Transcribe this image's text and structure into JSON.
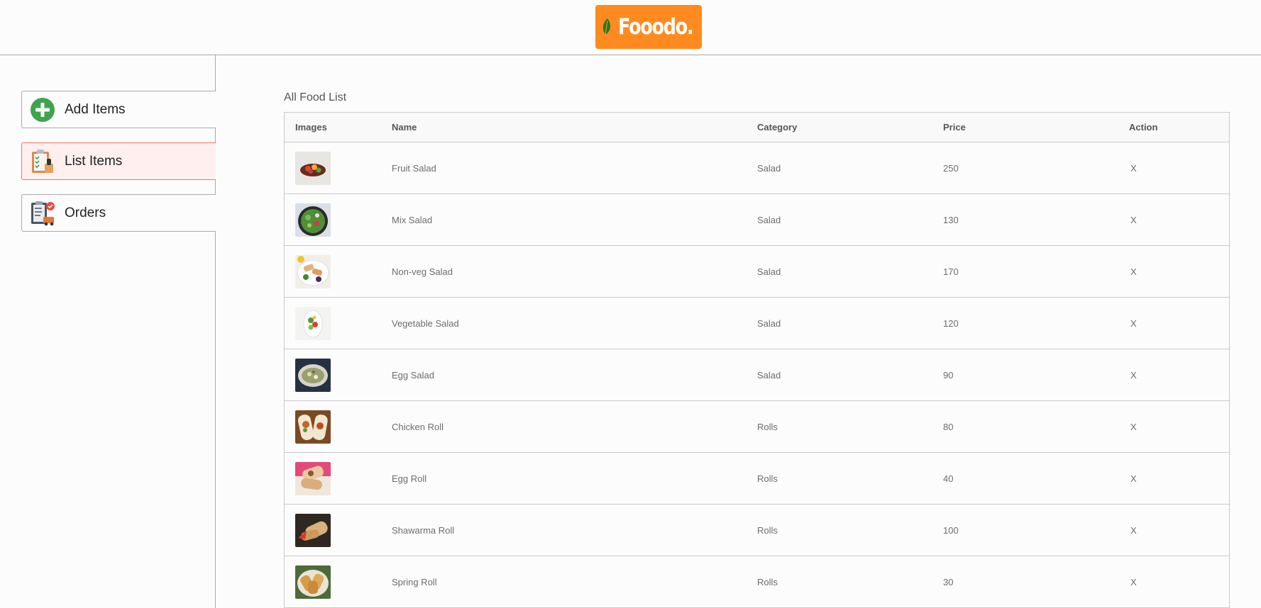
{
  "brand": {
    "name": "Fooodo.",
    "color": "#ff8a1f"
  },
  "sidebar": {
    "items": [
      {
        "label": "Add Items",
        "icon": "add-circle-icon"
      },
      {
        "label": "List Items",
        "icon": "clipboard-list-icon",
        "active": true
      },
      {
        "label": "Orders",
        "icon": "orders-icon"
      }
    ]
  },
  "list": {
    "title": "All Food List",
    "columns": [
      "Images",
      "Name",
      "Category",
      "Price",
      "Action"
    ],
    "rows": [
      {
        "image": "fruit-salad-image",
        "name": "Fruit Salad",
        "category": "Salad",
        "price": "250",
        "action": "X"
      },
      {
        "image": "mix-salad-image",
        "name": "Mix Salad",
        "category": "Salad",
        "price": "130",
        "action": "X"
      },
      {
        "image": "non-veg-salad-image",
        "name": "Non-veg Salad",
        "category": "Salad",
        "price": "170",
        "action": "X"
      },
      {
        "image": "vegetable-salad-image",
        "name": "Vegetable Salad",
        "category": "Salad",
        "price": "120",
        "action": "X"
      },
      {
        "image": "egg-salad-image",
        "name": "Egg Salad",
        "category": "Salad",
        "price": "90",
        "action": "X"
      },
      {
        "image": "chicken-roll-image",
        "name": "Chicken Roll",
        "category": "Rolls",
        "price": "80",
        "action": "X"
      },
      {
        "image": "egg-roll-image",
        "name": "Egg Roll",
        "category": "Rolls",
        "price": "40",
        "action": "X"
      },
      {
        "image": "shawarma-roll-image",
        "name": "Shawarma Roll",
        "category": "Rolls",
        "price": "100",
        "action": "X"
      },
      {
        "image": "spring-roll-image",
        "name": "Spring Roll",
        "category": "Rolls",
        "price": "30",
        "action": "X"
      }
    ]
  }
}
